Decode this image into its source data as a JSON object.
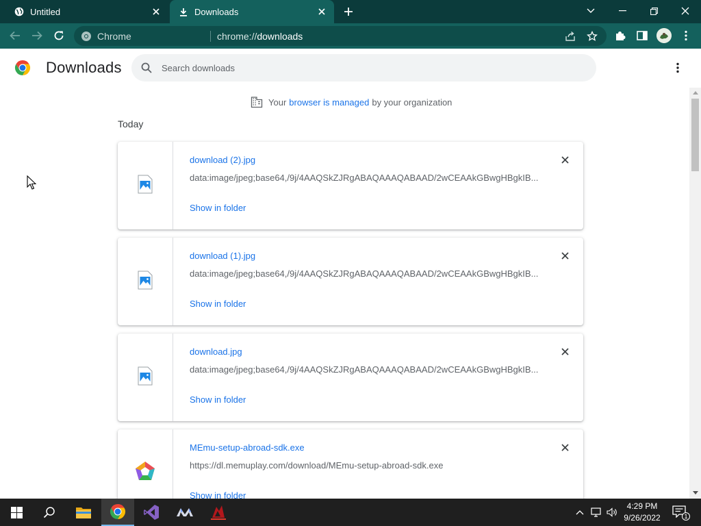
{
  "tabs": [
    {
      "title": "Untitled",
      "active": false
    },
    {
      "title": "Downloads",
      "active": true
    }
  ],
  "omnibox": {
    "site_chip": "Chrome",
    "url_scheme": "chrome://",
    "url_host": "downloads"
  },
  "page": {
    "title": "Downloads",
    "search_placeholder": "Search downloads",
    "managed_prefix": "Your",
    "managed_link": "browser is managed",
    "managed_suffix": "by your organization",
    "date_group": "Today"
  },
  "downloads": [
    {
      "name": "download (2).jpg",
      "url": "data:image/jpeg;base64,/9j/4AAQSkZJRgABAQAAAQABAAD/2wCEAAkGBwgHBgkIB...",
      "action": "Show in folder",
      "icon": "image-file-icon"
    },
    {
      "name": "download (1).jpg",
      "url": "data:image/jpeg;base64,/9j/4AAQSkZJRgABAQAAAQABAAD/2wCEAAkGBwgHBgkIB...",
      "action": "Show in folder",
      "icon": "image-file-icon"
    },
    {
      "name": "download.jpg",
      "url": "data:image/jpeg;base64,/9j/4AAQSkZJRgABAQAAAQABAAD/2wCEAAkGBwgHBgkIB...",
      "action": "Show in folder",
      "icon": "image-file-icon"
    },
    {
      "name": "MEmu-setup-abroad-sdk.exe",
      "url": "https://dl.memuplay.com/download/MEmu-setup-abroad-sdk.exe",
      "action": "Show in folder",
      "icon": "memu-app-icon"
    }
  ],
  "taskbar": {
    "time": "4:29 PM",
    "date": "9/26/2022",
    "notification_count": "1",
    "apps": [
      "windows-start-icon",
      "search-icon",
      "file-explorer-icon",
      "chrome-icon",
      "visual-studio-icon",
      "memu-icon",
      "game-icon"
    ]
  },
  "colors": {
    "tab_strip": "#0b3b3b",
    "toolbar": "#14615d",
    "link": "#1a73e8",
    "taskbar": "#1f1f1f"
  }
}
